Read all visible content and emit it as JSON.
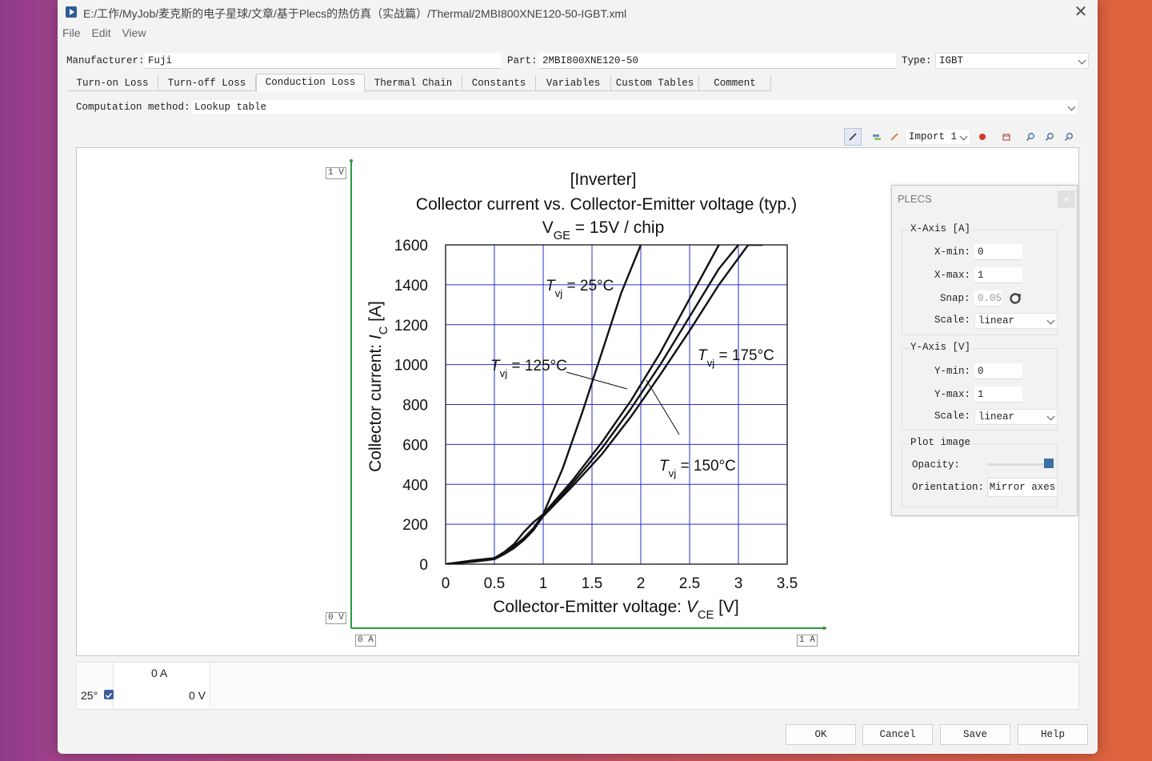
{
  "window": {
    "title": "E:/工作/MyJob/麦克斯的电子星球/文章/基于Plecs的热仿真（实战篇）/Thermal/2MBI800XNE120-50-IGBT.xml",
    "menu": [
      "File",
      "Edit",
      "View"
    ]
  },
  "header": {
    "manufacturer_label": "Manufacturer:",
    "manufacturer_value": "Fuji",
    "part_label": "Part:",
    "part_value": "2MBI800XNE120-50",
    "type_label": "Type:",
    "type_value": "IGBT"
  },
  "tabs": [
    "Turn-on Loss",
    "Turn-off Loss",
    "Conduction Loss",
    "Thermal Chain",
    "Constants",
    "Variables",
    "Custom Tables",
    "Comment"
  ],
  "active_tab": "Conduction Loss",
  "computation": {
    "label": "Computation method:",
    "value": "Lookup table"
  },
  "toolbar": {
    "import_label": "Import 1"
  },
  "plot_frame": {
    "y_top": "1 V",
    "y_bottom": "0 V",
    "x_left": "0 A",
    "x_right": "1 A"
  },
  "chart_data": {
    "type": "line",
    "title": "[Inverter]",
    "subtitle": "Collector current vs. Collector-Emitter voltage (typ.)",
    "condition": {
      "prefix": "V",
      "sub": "GE",
      "rest": " = 15V / chip"
    },
    "xlabel": {
      "text": "Collector-Emitter voltage: ",
      "sym": "V",
      "sub": "CE",
      "unit": " [V]"
    },
    "ylabel": {
      "text": "Collector current: ",
      "sym": "I",
      "sub": "C",
      "unit": " [A]"
    },
    "xlim": [
      0,
      3.5
    ],
    "ylim": [
      0,
      1600
    ],
    "xticks": [
      "0",
      "0.5",
      "1",
      "1.5",
      "2",
      "2.5",
      "3",
      "3.5"
    ],
    "yticks": [
      "0",
      "200",
      "400",
      "600",
      "800",
      "1000",
      "1200",
      "1400",
      "1600"
    ],
    "series": [
      {
        "label": "Tvj = 25°C",
        "x": [
          0,
          0.3,
          0.5,
          0.6,
          0.7,
          0.8,
          0.9,
          1.0,
          1.2,
          1.4,
          1.6,
          1.8,
          2.0
        ],
        "y": [
          0,
          20,
          30,
          60,
          100,
          160,
          210,
          250,
          480,
          760,
          1060,
          1360,
          1600
        ]
      },
      {
        "label": "Tvj = 125°C",
        "x": [
          0,
          0.3,
          0.5,
          0.6,
          0.7,
          0.8,
          0.9,
          1.0,
          1.3,
          1.6,
          1.9,
          2.2,
          2.5,
          2.8
        ],
        "y": [
          0,
          15,
          30,
          60,
          90,
          130,
          180,
          250,
          420,
          610,
          820,
          1060,
          1330,
          1600
        ]
      },
      {
        "label": "Tvj = 150°C",
        "x": [
          0,
          0.3,
          0.5,
          0.6,
          0.7,
          0.8,
          0.9,
          1.0,
          1.3,
          1.6,
          1.9,
          2.2,
          2.5,
          2.8,
          3.0
        ],
        "y": [
          0,
          14,
          28,
          55,
          85,
          125,
          175,
          245,
          405,
          580,
          780,
          1000,
          1240,
          1480,
          1600
        ]
      },
      {
        "label": "Tvj = 175°C",
        "x": [
          0,
          0.3,
          0.5,
          0.6,
          0.7,
          0.8,
          0.9,
          1.0,
          1.3,
          1.6,
          1.9,
          2.2,
          2.5,
          2.8,
          3.1,
          3.25
        ],
        "y": [
          0,
          13,
          25,
          50,
          80,
          120,
          170,
          240,
          390,
          550,
          740,
          950,
          1170,
          1400,
          1600,
          1600
        ]
      }
    ],
    "annotations": [
      {
        "base": "T",
        "sub": "vj",
        "rest": " = 25°C"
      },
      {
        "base": "T",
        "sub": "vj",
        "rest": " = 125°C"
      },
      {
        "base": "T",
        "sub": "vj",
        "rest": " = 175°C"
      },
      {
        "base": "T",
        "sub": "vj",
        "rest": " = 150°C"
      }
    ]
  },
  "panel": {
    "title": "PLECS",
    "close": "×",
    "x_axis": {
      "title": "X-Axis [A]",
      "min_label": "X-min:",
      "min": "0",
      "max_label": "X-max:",
      "max": "1",
      "snap_label": "Snap:",
      "snap": "0.05",
      "scale_label": "Scale:",
      "scale": "linear"
    },
    "y_axis": {
      "title": "Y-Axis [V]",
      "min_label": "Y-min:",
      "min": "0",
      "max_label": "Y-max:",
      "max": "1",
      "scale_label": "Scale:",
      "scale": "linear"
    },
    "plot_image": {
      "title": "Plot image",
      "opacity_label": "Opacity:",
      "opacity": 1.0,
      "orientation_label": "Orientation:",
      "orientation_button": "Mirror axes"
    }
  },
  "status": {
    "current": "0 A",
    "temp": "25°",
    "voltage": "0 V"
  },
  "buttons": {
    "ok": "OK",
    "cancel": "Cancel",
    "save": "Save",
    "help": "Help"
  },
  "colors": {
    "axis_green": "#2a9a3a",
    "grid_blue": "#2d2dc8",
    "slider_blue": "#3d6fa5"
  }
}
